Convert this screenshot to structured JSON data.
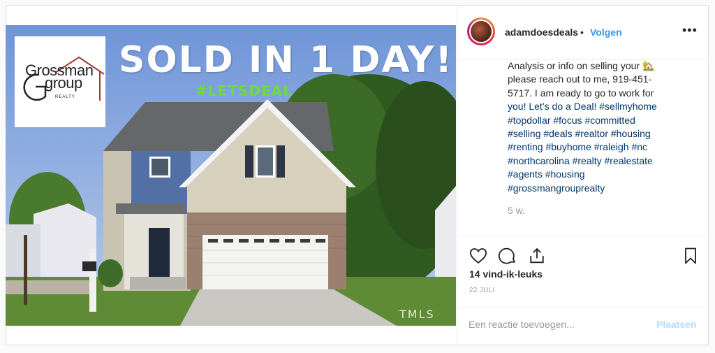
{
  "post": {
    "media": {
      "headline": "SOLD IN 1 DAY!",
      "hashtag_overlay": "#LETSDEAL",
      "logo": {
        "line1": "Grossman",
        "line2": "group",
        "line3": "REALTY"
      },
      "watermark": "TMLS"
    },
    "header": {
      "username": "adamdoesdeals",
      "separator": "•",
      "follow_label": "Volgen",
      "more_icon": "more-options-icon"
    },
    "caption_lines": [
      "Analysis or info on selling your 🏡",
      "please reach out to me, 919-451-",
      "5717. I am ready to go to work for",
      "you! Let’s do a Deal! #sellmyhome",
      "#topdollar #focus #committed",
      "#selling #deals #realtor #housing",
      "#renting #buyhome #raleigh #nc",
      "#northcarolina #realty #realestate",
      "#agents #housing",
      "#grossmangrouprealty"
    ],
    "time_ago": "5 w.",
    "likes": "14 vind-ik-leuks",
    "date": "22 JULI",
    "comment": {
      "placeholder": "Een reactie toevoegen...",
      "post_label": "Plaatsen"
    },
    "colors": {
      "accent": "#3897f0",
      "post_disabled": "#b3dbff",
      "hashtag_link": "#003569"
    }
  }
}
